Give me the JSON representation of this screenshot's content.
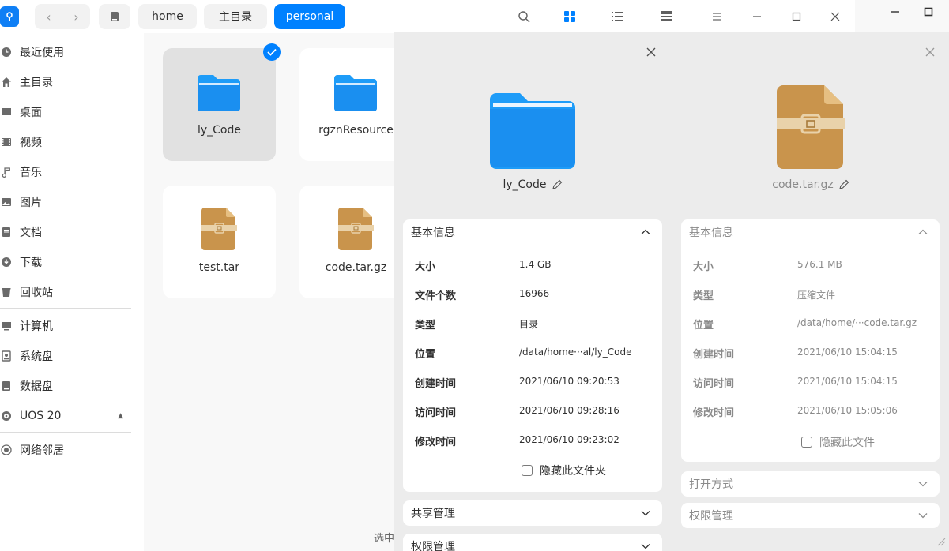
{
  "breadcrumbs": [
    "home",
    "主目录",
    "personal"
  ],
  "sidebar": {
    "items": [
      {
        "label": "最近使用",
        "icon": "clock-icon"
      },
      {
        "label": "主目录",
        "icon": "home-icon"
      },
      {
        "label": "桌面",
        "icon": "desktop-icon"
      },
      {
        "label": "视频",
        "icon": "video-icon"
      },
      {
        "label": "音乐",
        "icon": "music-icon"
      },
      {
        "label": "图片",
        "icon": "picture-icon"
      },
      {
        "label": "文档",
        "icon": "document-icon"
      },
      {
        "label": "下载",
        "icon": "download-icon"
      },
      {
        "label": "回收站",
        "icon": "trash-icon"
      },
      {
        "label": "计算机",
        "icon": "computer-icon"
      },
      {
        "label": "系统盘",
        "icon": "disk-icon"
      },
      {
        "label": "数据盘",
        "icon": "disk-icon"
      },
      {
        "label": "UOS 20",
        "icon": "optical-disc-icon"
      },
      {
        "label": "网络邻居",
        "icon": "network-icon"
      }
    ]
  },
  "files": [
    {
      "name": "ly_Code",
      "kind": "folder",
      "selected": true
    },
    {
      "name": "rgznResource",
      "kind": "folder",
      "selected": false
    },
    {
      "name": "test.tar",
      "kind": "archive",
      "selected": false
    },
    {
      "name": "code.tar.gz",
      "kind": "archive",
      "selected": false
    }
  ],
  "status_text": "选中",
  "dialog_a": {
    "name": "ly_Code",
    "basic_title": "基本信息",
    "rows": [
      {
        "k": "大小",
        "v": "1.4 GB"
      },
      {
        "k": "文件个数",
        "v": "16966"
      },
      {
        "k": "类型",
        "v": "目录"
      },
      {
        "k": "位置",
        "v": "/data/home···al/ly_Code"
      },
      {
        "k": "创建时间",
        "v": "2021/06/10 09:20:53"
      },
      {
        "k": "访问时间",
        "v": "2021/06/10 09:28:16"
      },
      {
        "k": "修改时间",
        "v": "2021/06/10 09:23:02"
      }
    ],
    "hide_label": "隐藏此文件夹",
    "share_title": "共享管理",
    "perm_title": "权限管理"
  },
  "dialog_b": {
    "name": "code.tar.gz",
    "basic_title": "基本信息",
    "rows": [
      {
        "k": "大小",
        "v": "576.1 MB"
      },
      {
        "k": "类型",
        "v": "压缩文件"
      },
      {
        "k": "位置",
        "v": "/data/home/···code.tar.gz"
      },
      {
        "k": "创建时间",
        "v": "2021/06/10 15:04:15"
      },
      {
        "k": "访问时间",
        "v": "2021/06/10 15:04:15"
      },
      {
        "k": "修改时间",
        "v": "2021/06/10 15:05:06"
      }
    ],
    "hide_label": "隐藏此文件",
    "open_title": "打开方式",
    "perm_title": "权限管理"
  },
  "colors": {
    "accent": "#0081ff",
    "folder": "#1e9cf8",
    "archive": "#c9944c"
  }
}
